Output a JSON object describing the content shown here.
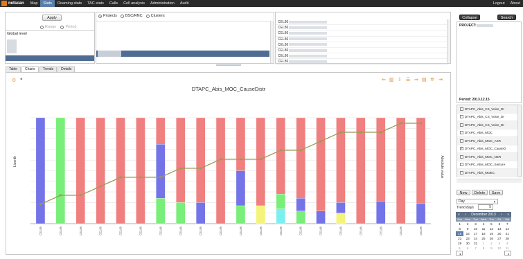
{
  "app": {
    "logo_text": "netscan"
  },
  "nav": {
    "items": [
      {
        "label": "Map",
        "active": false
      },
      {
        "label": "Stats",
        "active": true
      },
      {
        "label": "Roaming stats",
        "active": false
      },
      {
        "label": "TAC stats",
        "active": false
      },
      {
        "label": "Calls",
        "active": false
      },
      {
        "label": "Cell analysis",
        "active": false
      },
      {
        "label": "Administration",
        "active": false
      },
      {
        "label": "Audit",
        "active": false
      }
    ],
    "logout": "Logout",
    "about": "About"
  },
  "filter": {
    "apply_label": "Apply",
    "opt_range": "Range",
    "opt_period": "Period",
    "global_level": "Global level"
  },
  "scope": {
    "radios": [
      {
        "label": "Projects",
        "checked": true
      },
      {
        "label": "BSC/RNC",
        "checked": false
      },
      {
        "label": "Clusters",
        "checked": false
      }
    ]
  },
  "cells": {
    "rows": [
      "CEL86",
      "CEL86",
      "CEL86",
      "CEL86",
      "CEL86",
      "CEL86",
      "CEL86",
      "CEL86"
    ]
  },
  "tabs": [
    {
      "label": "Table",
      "active": false
    },
    {
      "label": "Charts",
      "active": true
    },
    {
      "label": "Trends",
      "active": false
    },
    {
      "label": "Details",
      "active": false
    }
  ],
  "right": {
    "collapse_label": "Collapse",
    "search_label": "Search",
    "project_label": "PROJECT:",
    "period_label": "Period: 2013.12.15",
    "kpis": [
      {
        "label": "DTAPC_Abis_CS_Voice_Dr",
        "checked": false
      },
      {
        "label": "DTAPC_Abis_CS_Voice_Dr",
        "checked": false
      },
      {
        "label": "DTAPC_Abis_CS_Voice_Dr",
        "checked": false
      },
      {
        "label": "DTAPC_Abis_MOC",
        "checked": false
      },
      {
        "label": "DTAPC_Abis_MOC_ASR",
        "checked": false
      },
      {
        "label": "DTAPC_Abis_MOC_CauseD",
        "checked": true
      },
      {
        "label": "DTAPC_Abis_MOC_NER",
        "checked": false
      },
      {
        "label": "DTAPC_Abis_MOC_Seizure",
        "checked": false
      },
      {
        "label": "DTAPC_Abis_MOEC",
        "checked": false
      }
    ],
    "new_label": "New",
    "delete_label": "Delete",
    "save_label": "Save",
    "granularity": "Day",
    "trend_days_label": "Trend days",
    "trend_days_value": "5"
  },
  "calendar": {
    "month_label": "December 2013",
    "dow": [
      "Sun",
      "Mon",
      "Tue",
      "Wed",
      "Thu",
      "Fri",
      "Sat"
    ],
    "days": [
      {
        "d": "1",
        "o": false
      },
      {
        "d": "2",
        "o": false
      },
      {
        "d": "3",
        "o": false
      },
      {
        "d": "4",
        "o": false
      },
      {
        "d": "5",
        "o": false
      },
      {
        "d": "6",
        "o": false
      },
      {
        "d": "7",
        "o": false
      },
      {
        "d": "8",
        "o": false
      },
      {
        "d": "9",
        "o": false
      },
      {
        "d": "10",
        "o": false
      },
      {
        "d": "11",
        "o": false
      },
      {
        "d": "12",
        "o": false
      },
      {
        "d": "13",
        "o": false
      },
      {
        "d": "14",
        "o": false
      },
      {
        "d": "15",
        "o": false,
        "today": true
      },
      {
        "d": "16",
        "o": false
      },
      {
        "d": "17",
        "o": false
      },
      {
        "d": "18",
        "o": false
      },
      {
        "d": "19",
        "o": false
      },
      {
        "d": "20",
        "o": false
      },
      {
        "d": "21",
        "o": false
      },
      {
        "d": "22",
        "o": false
      },
      {
        "d": "23",
        "o": false
      },
      {
        "d": "24",
        "o": false
      },
      {
        "d": "25",
        "o": false
      },
      {
        "d": "26",
        "o": false
      },
      {
        "d": "27",
        "o": false
      },
      {
        "d": "28",
        "o": false
      },
      {
        "d": "29",
        "o": false
      },
      {
        "d": "30",
        "o": false
      },
      {
        "d": "31",
        "o": false
      },
      {
        "d": "1",
        "o": true
      },
      {
        "d": "2",
        "o": true
      },
      {
        "d": "3",
        "o": true
      },
      {
        "d": "4",
        "o": true
      },
      {
        "d": "5",
        "o": true
      },
      {
        "d": "6",
        "o": true
      },
      {
        "d": "7",
        "o": true
      },
      {
        "d": "8",
        "o": true
      },
      {
        "d": "9",
        "o": true
      },
      {
        "d": "10",
        "o": true
      },
      {
        "d": "11",
        "o": true
      }
    ]
  },
  "colors": {
    "red": "#f08080",
    "blue": "#7474e8",
    "green": "#79ee79",
    "yellow": "#f4f47a",
    "cyan": "#7cf0f0",
    "line": "#9a9a56",
    "nav_active": "#5b7fa8",
    "icon_orange": "#e08a2a"
  },
  "chart_data": {
    "type": "bar",
    "stacked": true,
    "title": "DTAPC_Abis_MOC_CauseDistr",
    "ylabel": "Lizenth",
    "y2label": "Absolute value",
    "grid": true,
    "categories": [
      "CEL86",
      "CEL86",
      "CEL86",
      "CEL86",
      "CEL86",
      "CEL86",
      "CEL86",
      "CEL86",
      "CEL86",
      "CEL86",
      "CEL86",
      "CEL86",
      "CEL86",
      "CEL86",
      "CEL86",
      "CEL86",
      "CEL86",
      "CEL86",
      "CEL86",
      "CEL86"
    ],
    "series": [
      {
        "color": "blue",
        "values": [
          100,
          0,
          0,
          0,
          0,
          0,
          0,
          20,
          0,
          0,
          0,
          0,
          0,
          0,
          0,
          0,
          0,
          0,
          0,
          0
        ]
      },
      {
        "color": "green",
        "values": [
          0,
          100,
          0,
          0,
          0,
          0,
          0,
          0,
          0,
          0,
          0,
          0,
          0,
          0,
          0,
          0,
          0,
          0,
          0,
          0
        ]
      },
      {
        "color": "yellow",
        "values": [
          0,
          0,
          0,
          0,
          0,
          0,
          0,
          0,
          0,
          0,
          0,
          0,
          0,
          0,
          0,
          0,
          0,
          0,
          0,
          0
        ]
      },
      {
        "color": "cyan",
        "values": [
          0,
          0,
          0,
          0,
          0,
          0,
          0,
          0,
          0,
          0,
          0,
          0,
          0,
          0,
          0,
          0,
          0,
          0,
          0,
          0
        ]
      },
      {
        "color": "red",
        "values": [
          0,
          0,
          100,
          100,
          100,
          100,
          100,
          80,
          100,
          100,
          100,
          100,
          100,
          100,
          100,
          100,
          100,
          100,
          100,
          100
        ]
      }
    ],
    "series_detail": [
      [
        {
          "c": "blue",
          "v": 100
        }
      ],
      [
        {
          "c": "green",
          "v": 100
        }
      ],
      [
        {
          "c": "red",
          "v": 100
        }
      ],
      [
        {
          "c": "red",
          "v": 100
        }
      ],
      [
        {
          "c": "red",
          "v": 100
        }
      ],
      [
        {
          "c": "red",
          "v": 100
        }
      ],
      [
        {
          "c": "green",
          "v": 24
        },
        {
          "c": "blue",
          "v": 51
        },
        {
          "c": "red",
          "v": 25
        }
      ],
      [
        {
          "c": "green",
          "v": 20
        },
        {
          "c": "red",
          "v": 80
        }
      ],
      [
        {
          "c": "blue",
          "v": 20
        },
        {
          "c": "red",
          "v": 80
        }
      ],
      [
        {
          "c": "red",
          "v": 100
        }
      ],
      [
        {
          "c": "green",
          "v": 17
        },
        {
          "c": "blue",
          "v": 33
        },
        {
          "c": "red",
          "v": 50
        }
      ],
      [
        {
          "c": "yellow",
          "v": 17
        },
        {
          "c": "red",
          "v": 83
        }
      ],
      [
        {
          "c": "cyan",
          "v": 14
        },
        {
          "c": "green",
          "v": 14
        },
        {
          "c": "red",
          "v": 72
        }
      ],
      [
        {
          "c": "green",
          "v": 12
        },
        {
          "c": "blue",
          "v": 12
        },
        {
          "c": "red",
          "v": 76
        }
      ],
      [
        {
          "c": "blue",
          "v": 12
        },
        {
          "c": "red",
          "v": 88
        }
      ],
      [
        {
          "c": "yellow",
          "v": 10
        },
        {
          "c": "blue",
          "v": 10
        },
        {
          "c": "red",
          "v": 80
        }
      ],
      [
        {
          "c": "red",
          "v": 100
        }
      ],
      [
        {
          "c": "blue",
          "v": 21
        },
        {
          "c": "red",
          "v": 79
        }
      ],
      [
        {
          "c": "red",
          "v": 100
        }
      ],
      [
        {
          "c": "blue",
          "v": 19
        },
        {
          "c": "red",
          "v": 81
        }
      ]
    ],
    "line_values": [
      1,
      2,
      2,
      3,
      4,
      4,
      4,
      5,
      5,
      6,
      6,
      6,
      7,
      7,
      8,
      9,
      9,
      9,
      10,
      10
    ],
    "line_max": 10
  }
}
